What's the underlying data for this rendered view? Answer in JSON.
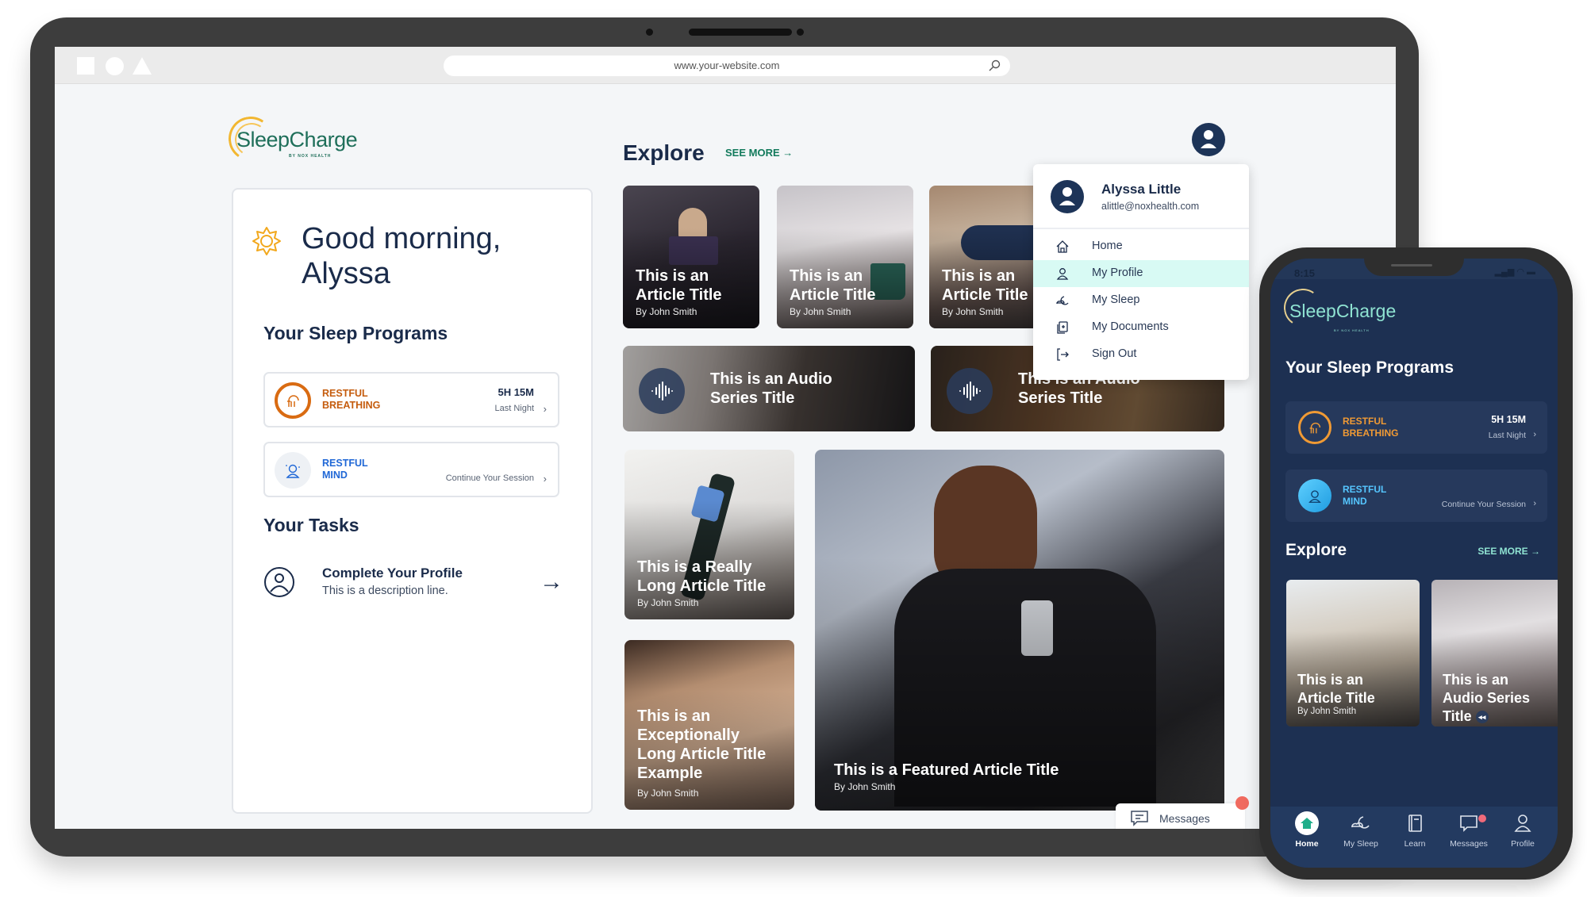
{
  "browser": {
    "url": "www.your-website.com"
  },
  "brand": {
    "name": "SleepCharge",
    "byline": "BY NOX HEALTH",
    "accent": "#127a5c",
    "navy": "#1a2b4a"
  },
  "dashboard": {
    "greeting_line1": "Good morning,",
    "greeting_line2": "Alyssa",
    "sleep_programs_title": "Your Sleep Programs",
    "programs": [
      {
        "name_line1": "RESTFUL",
        "name_line2": "BREATHING",
        "metric": "5H 15M",
        "sub": "Last Night",
        "color": "#c55c0d"
      },
      {
        "name_line1": "RESTFUL",
        "name_line2": "MIND",
        "metric": "",
        "sub": "Continue Your Session",
        "color": "#1f67d6"
      }
    ],
    "tasks_title": "Your Tasks",
    "tasks": [
      {
        "title": "Complete Your Profile",
        "description": "This is a description line."
      }
    ]
  },
  "explore": {
    "title": "Explore",
    "see_more": "SEE MORE →",
    "articles": [
      {
        "title_line1": "This is an",
        "title_line2": "Article  Title",
        "author": "By John Smith"
      },
      {
        "title_line1": "This is an",
        "title_line2": "Article  Title",
        "author": "By John Smith"
      },
      {
        "title_line1": "This is an",
        "title_line2": "Article  Title",
        "author": "By John Smith"
      }
    ],
    "audio": [
      {
        "title_line1": "This is an Audio",
        "title_line2": "Series Title"
      },
      {
        "title_line1": "This is an Audio",
        "title_line2": "Series Title"
      }
    ],
    "long_articles": [
      {
        "lines": [
          "This is a Really",
          "Long Article  Title"
        ],
        "author": "By John Smith"
      },
      {
        "lines": [
          "This is an",
          "Exceptionally",
          "Long Article  Title",
          "Example"
        ],
        "author": "By John Smith"
      }
    ],
    "featured": {
      "title": "This is a Featured Article Title",
      "author": "By John Smith"
    }
  },
  "user_menu": {
    "name": "Alyssa Little",
    "email": "alittle@noxhealth.com",
    "items": [
      {
        "label": "Home",
        "icon": "home-icon",
        "active": false
      },
      {
        "label": "My Profile",
        "icon": "user-icon",
        "active": true
      },
      {
        "label": "My Sleep",
        "icon": "moon-cloud-icon",
        "active": false
      },
      {
        "label": "My Documents",
        "icon": "documents-icon",
        "active": false
      },
      {
        "label": "Sign Out",
        "icon": "sign-out-icon",
        "active": false
      }
    ]
  },
  "messages": {
    "label": "Messages",
    "has_unread": true
  },
  "phone": {
    "time": "8:15",
    "sleep_programs_title": "Your Sleep Programs",
    "programs": [
      {
        "name_line1": "RESTFUL",
        "name_line2": "BREATHING",
        "metric": "5H 15M",
        "sub": "Last Night"
      },
      {
        "name_line1": "RESTFUL",
        "name_line2": "MIND",
        "metric": "",
        "sub": "Continue Your Session"
      }
    ],
    "explore_title": "Explore",
    "see_more": "SEE MORE →",
    "cards": [
      {
        "title_line1": "This is an",
        "title_line2": "Article Title",
        "author": "By John Smith"
      },
      {
        "title_line1": "This is an",
        "title_line2": "Audio Series",
        "title_line3": "Title"
      }
    ],
    "tabs": [
      {
        "label": "Home",
        "active": true
      },
      {
        "label": "My Sleep",
        "active": false
      },
      {
        "label": "Learn",
        "active": false
      },
      {
        "label": "Messages",
        "active": false,
        "badge": true
      },
      {
        "label": "Profile",
        "active": false
      }
    ]
  }
}
